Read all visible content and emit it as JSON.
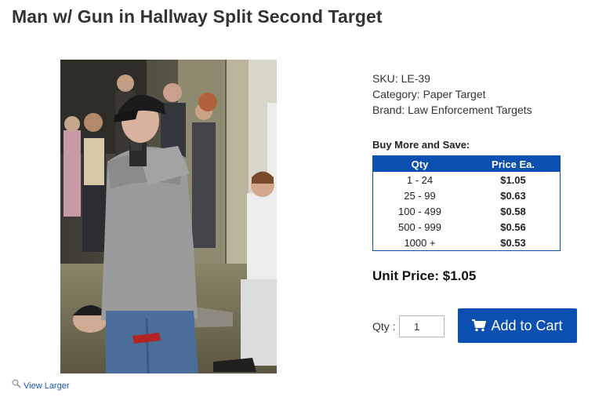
{
  "product": {
    "title": "Man w/ Gun in Hallway Split Second Target",
    "image_alt": "Man w/ Gun in Hallway Split Second Target",
    "view_larger": "View Larger",
    "sku": "SKU: LE-39",
    "category": "Category: Paper Target",
    "brand": "Brand: Law Enforcement Targets"
  },
  "pricing": {
    "bulk_title": "Buy More and Save:",
    "headers": [
      "Qty",
      "Price Ea."
    ],
    "rows": [
      {
        "qty": "1 - 24",
        "price": "$1.05"
      },
      {
        "qty": "25 - 99",
        "price": "$0.63"
      },
      {
        "qty": "100 - 499",
        "price": "$0.58"
      },
      {
        "qty": "500 - 999",
        "price": "$0.56"
      },
      {
        "qty": "1000 +",
        "price": "$0.53"
      }
    ],
    "unit_price": "Unit Price: $1.05"
  },
  "cart": {
    "qty_label": "Qty :",
    "qty_value": "1",
    "add_label": "Add to Cart",
    "icon": "shopping-cart-icon"
  },
  "colors": {
    "accent": "#0b4fb0",
    "link": "#1a55b5"
  }
}
